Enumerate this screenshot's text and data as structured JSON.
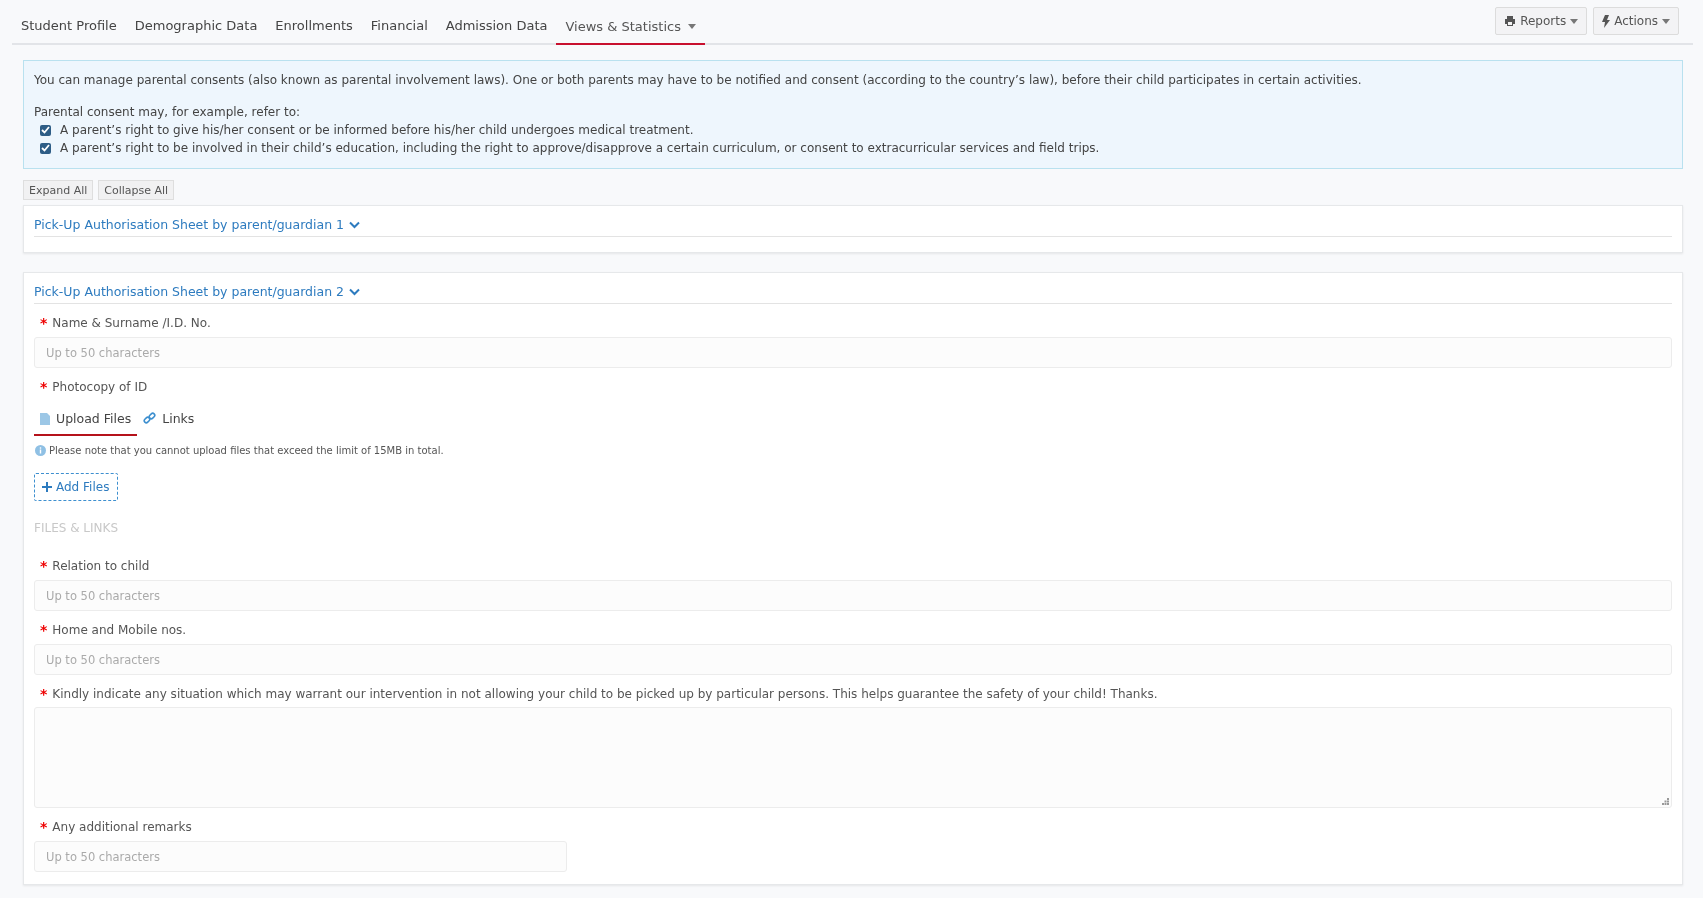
{
  "nav_tabs": [
    {
      "label": "Student Profile",
      "selected": false,
      "dropdown": false
    },
    {
      "label": "Demographic Data",
      "selected": false,
      "dropdown": false
    },
    {
      "label": "Enrollments",
      "selected": false,
      "dropdown": false
    },
    {
      "label": "Financial",
      "selected": false,
      "dropdown": false
    },
    {
      "label": "Admission Data",
      "selected": false,
      "dropdown": false
    },
    {
      "label": "Views & Statistics",
      "selected": true,
      "dropdown": true
    }
  ],
  "toolbar_buttons": [
    {
      "label": "Reports"
    },
    {
      "label": "Actions"
    }
  ],
  "info": {
    "intro": "You can manage parental consents (also known as parental involvement laws). One or both parents may have to be notified and consent (according to the country’s law), before their child participates in certain activities.",
    "list_heading": "Parental consent may, for example, refer to:",
    "items": [
      {
        "text": "A parent’s right to give his/her consent or be informed before his/her child undergoes medical treatment.",
        "checked": true
      },
      {
        "text": "A parent’s right to be involved in their child’s education, including the right to approve/disapprove a certain curriculum, or consent to extracurricular services and field trips.",
        "checked": true
      }
    ]
  },
  "expand_controls": [
    "Expand All",
    "Collapse All"
  ],
  "sections": [
    {
      "title": "Pick-Up Authorisation Sheet by parent/guardian 1"
    },
    {
      "title": "Pick-Up Authorisation Sheet by parent/guardian 2",
      "fields": [
        {
          "kind": "text",
          "label": "Name & Surname /I.D. No.",
          "required_mark": "*",
          "placeholder": "Up to 50 characters"
        },
        {
          "kind": "files",
          "label": "Photocopy of ID",
          "required_mark": "*",
          "tabs": [
            {
              "label": "Upload Files",
              "selected": true
            },
            {
              "label": "Links",
              "selected": false
            }
          ],
          "note": "Please note that you cannot upload files that exceed the limit of 15MB in total.",
          "add_button": "Add Files",
          "list_heading": "FILES & LINKS"
        },
        {
          "kind": "text",
          "label": "Relation to child",
          "required_mark": "*",
          "placeholder": "Up to 50 characters"
        },
        {
          "kind": "text",
          "label": "Home and Mobile nos.",
          "required_mark": "*",
          "placeholder": "Up to 50 characters"
        },
        {
          "kind": "textarea",
          "label": "Kindly indicate any situation which may warrant our intervention in not allowing your child to be picked up by particular persons. This helps guarantee the safety of your child! Thanks.",
          "required_mark": "*"
        },
        {
          "kind": "short_text",
          "label": "Any additional remarks",
          "required_mark": "*",
          "placeholder": "Up to 50 characters"
        }
      ]
    }
  ]
}
